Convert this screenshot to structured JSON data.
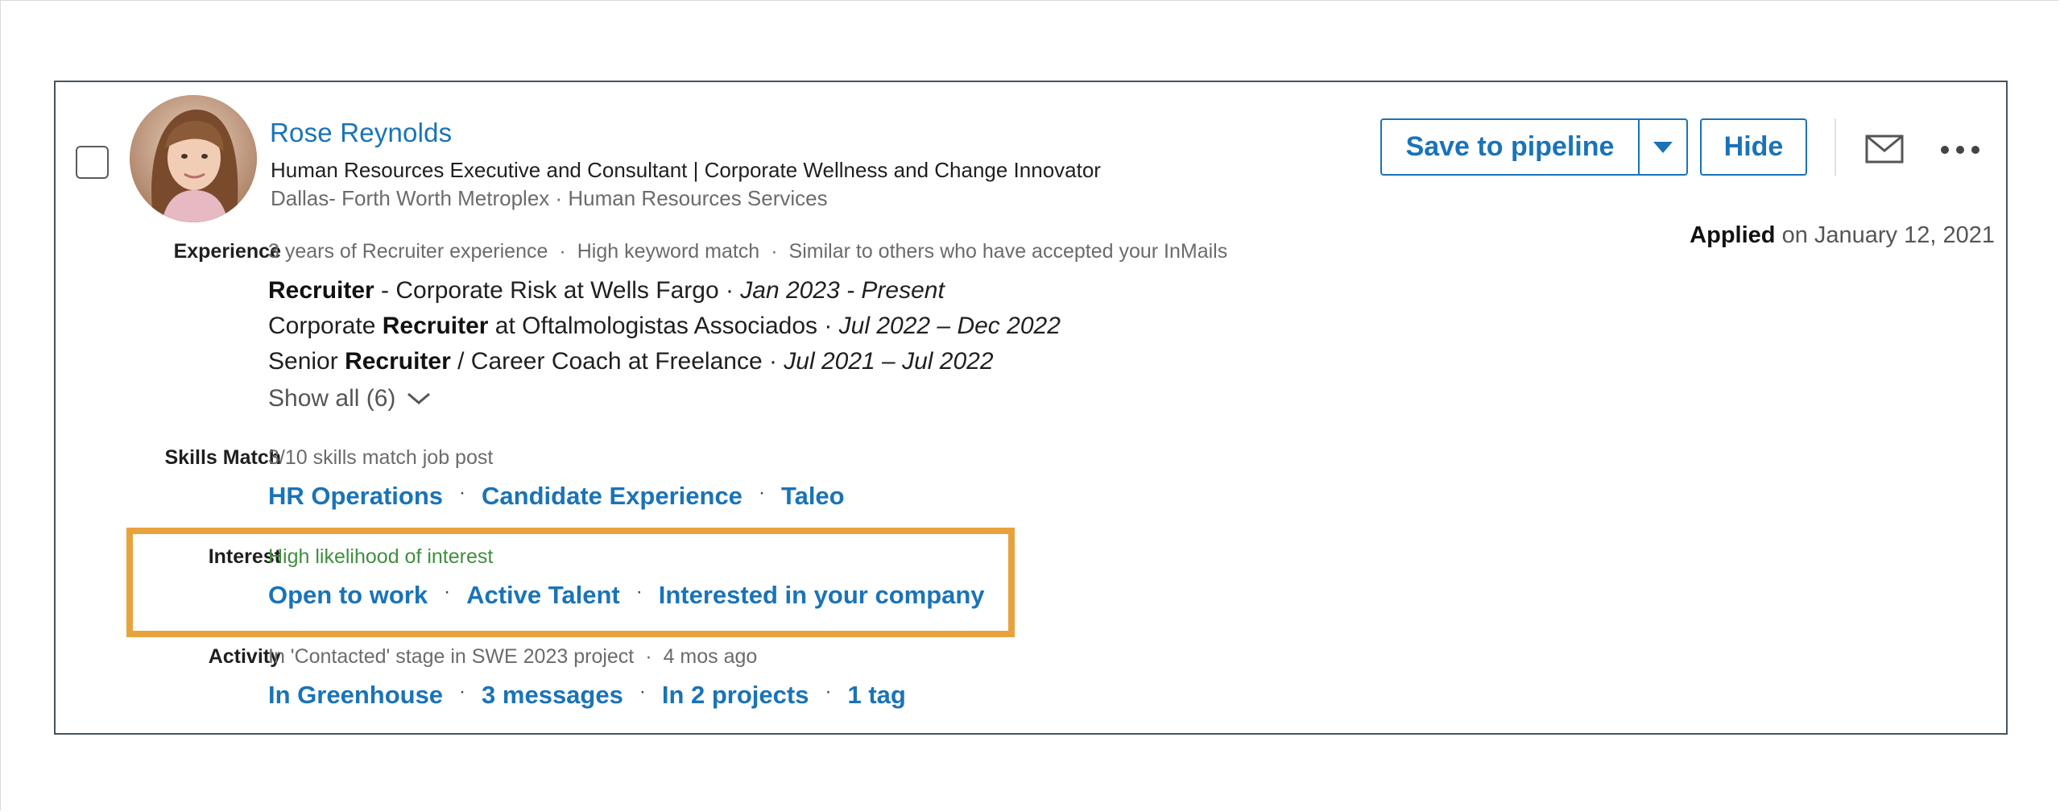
{
  "candidate": {
    "name": "Rose Reynolds",
    "headline": "Human Resources Executive and Consultant | Corporate Wellness and Change Innovator",
    "location": "Dallas- Forth Worth Metroplex · Human Resources Services"
  },
  "actions": {
    "save_label": "Save to pipeline",
    "hide_label": "Hide"
  },
  "applied": {
    "label": "Applied",
    "date": "on January 12, 2021"
  },
  "experience": {
    "label": "Experience",
    "summary": [
      "3 years of Recruiter experience",
      "High keyword match",
      "Similar to others who have accepted your InMails"
    ],
    "positions": [
      {
        "pre": "",
        "bold": "Recruiter",
        "post": " - Corporate Risk at Wells Fargo · ",
        "dates": "Jan 2023 - Present"
      },
      {
        "pre": "Corporate ",
        "bold": "Recruiter",
        "post": " at Oftalmologistas Associados · ",
        "dates": "Jul 2022 – Dec 2022"
      },
      {
        "pre": "Senior ",
        "bold": "Recruiter",
        "post": " / Career Coach at Freelance · ",
        "dates": "Jul 2021 – Jul 2022"
      }
    ],
    "show_all": "Show all (6)"
  },
  "skills": {
    "label": "Skills Match",
    "summary": "3/10 skills match job post",
    "items": [
      "HR Operations",
      "Candidate Experience",
      "Taleo"
    ]
  },
  "interest": {
    "label": "Interest",
    "summary": "High likelihood of interest",
    "items": [
      "Open to work",
      "Active Talent",
      "Interested in your company"
    ]
  },
  "activity": {
    "label": "Activity",
    "summary_stage": "In 'Contacted' stage in SWE 2023 project",
    "summary_time": "4 mos ago",
    "items": [
      "In Greenhouse",
      "3 messages",
      "In 2 projects",
      "1 tag"
    ]
  },
  "colors": {
    "link": "#1a73b8",
    "highlight": "#e8a23d",
    "interest_green": "#3f8f3f"
  },
  "icons": [
    "checkbox",
    "avatar",
    "caret-down-icon",
    "mail-icon",
    "more-icon",
    "chevron-down-icon"
  ]
}
